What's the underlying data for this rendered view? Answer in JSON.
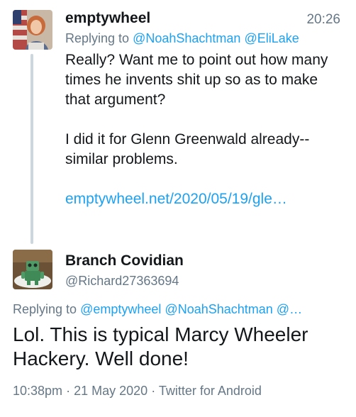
{
  "parent_tweet": {
    "display_name": "emptywheel",
    "time": "20:26",
    "replying_to_prefix": "Replying to",
    "replying_to": [
      "@NoahShachtman",
      "@EliLake"
    ],
    "text_paragraph_1": "Really? Want me to point out how many times he invents shit up so as to make that argument?",
    "text_paragraph_2": "I did it for Glenn Greenwald already--similar problems.",
    "link": "emptywheel.net/2020/05/19/gle…",
    "avatar_icon": "profile-photo"
  },
  "reply_tweet": {
    "display_name": "Branch Covidian",
    "handle": "@Richard27363694",
    "replying_to_prefix": "Replying to",
    "replying_to": [
      "@emptywheel",
      "@NoahShachtman",
      "@…"
    ],
    "text": "Lol. This is typical Marcy Wheeler Hackery. Well done!",
    "timestamp": "10:38pm",
    "date": "21 May 2020",
    "source": "Twitter for Android",
    "separator": "·",
    "avatar_icon": "robot-figurine-photo"
  },
  "colors": {
    "link": "#1da1f2",
    "secondary_text": "#657786",
    "primary_text": "#14171a",
    "thread_line": "#ccd6dd"
  }
}
